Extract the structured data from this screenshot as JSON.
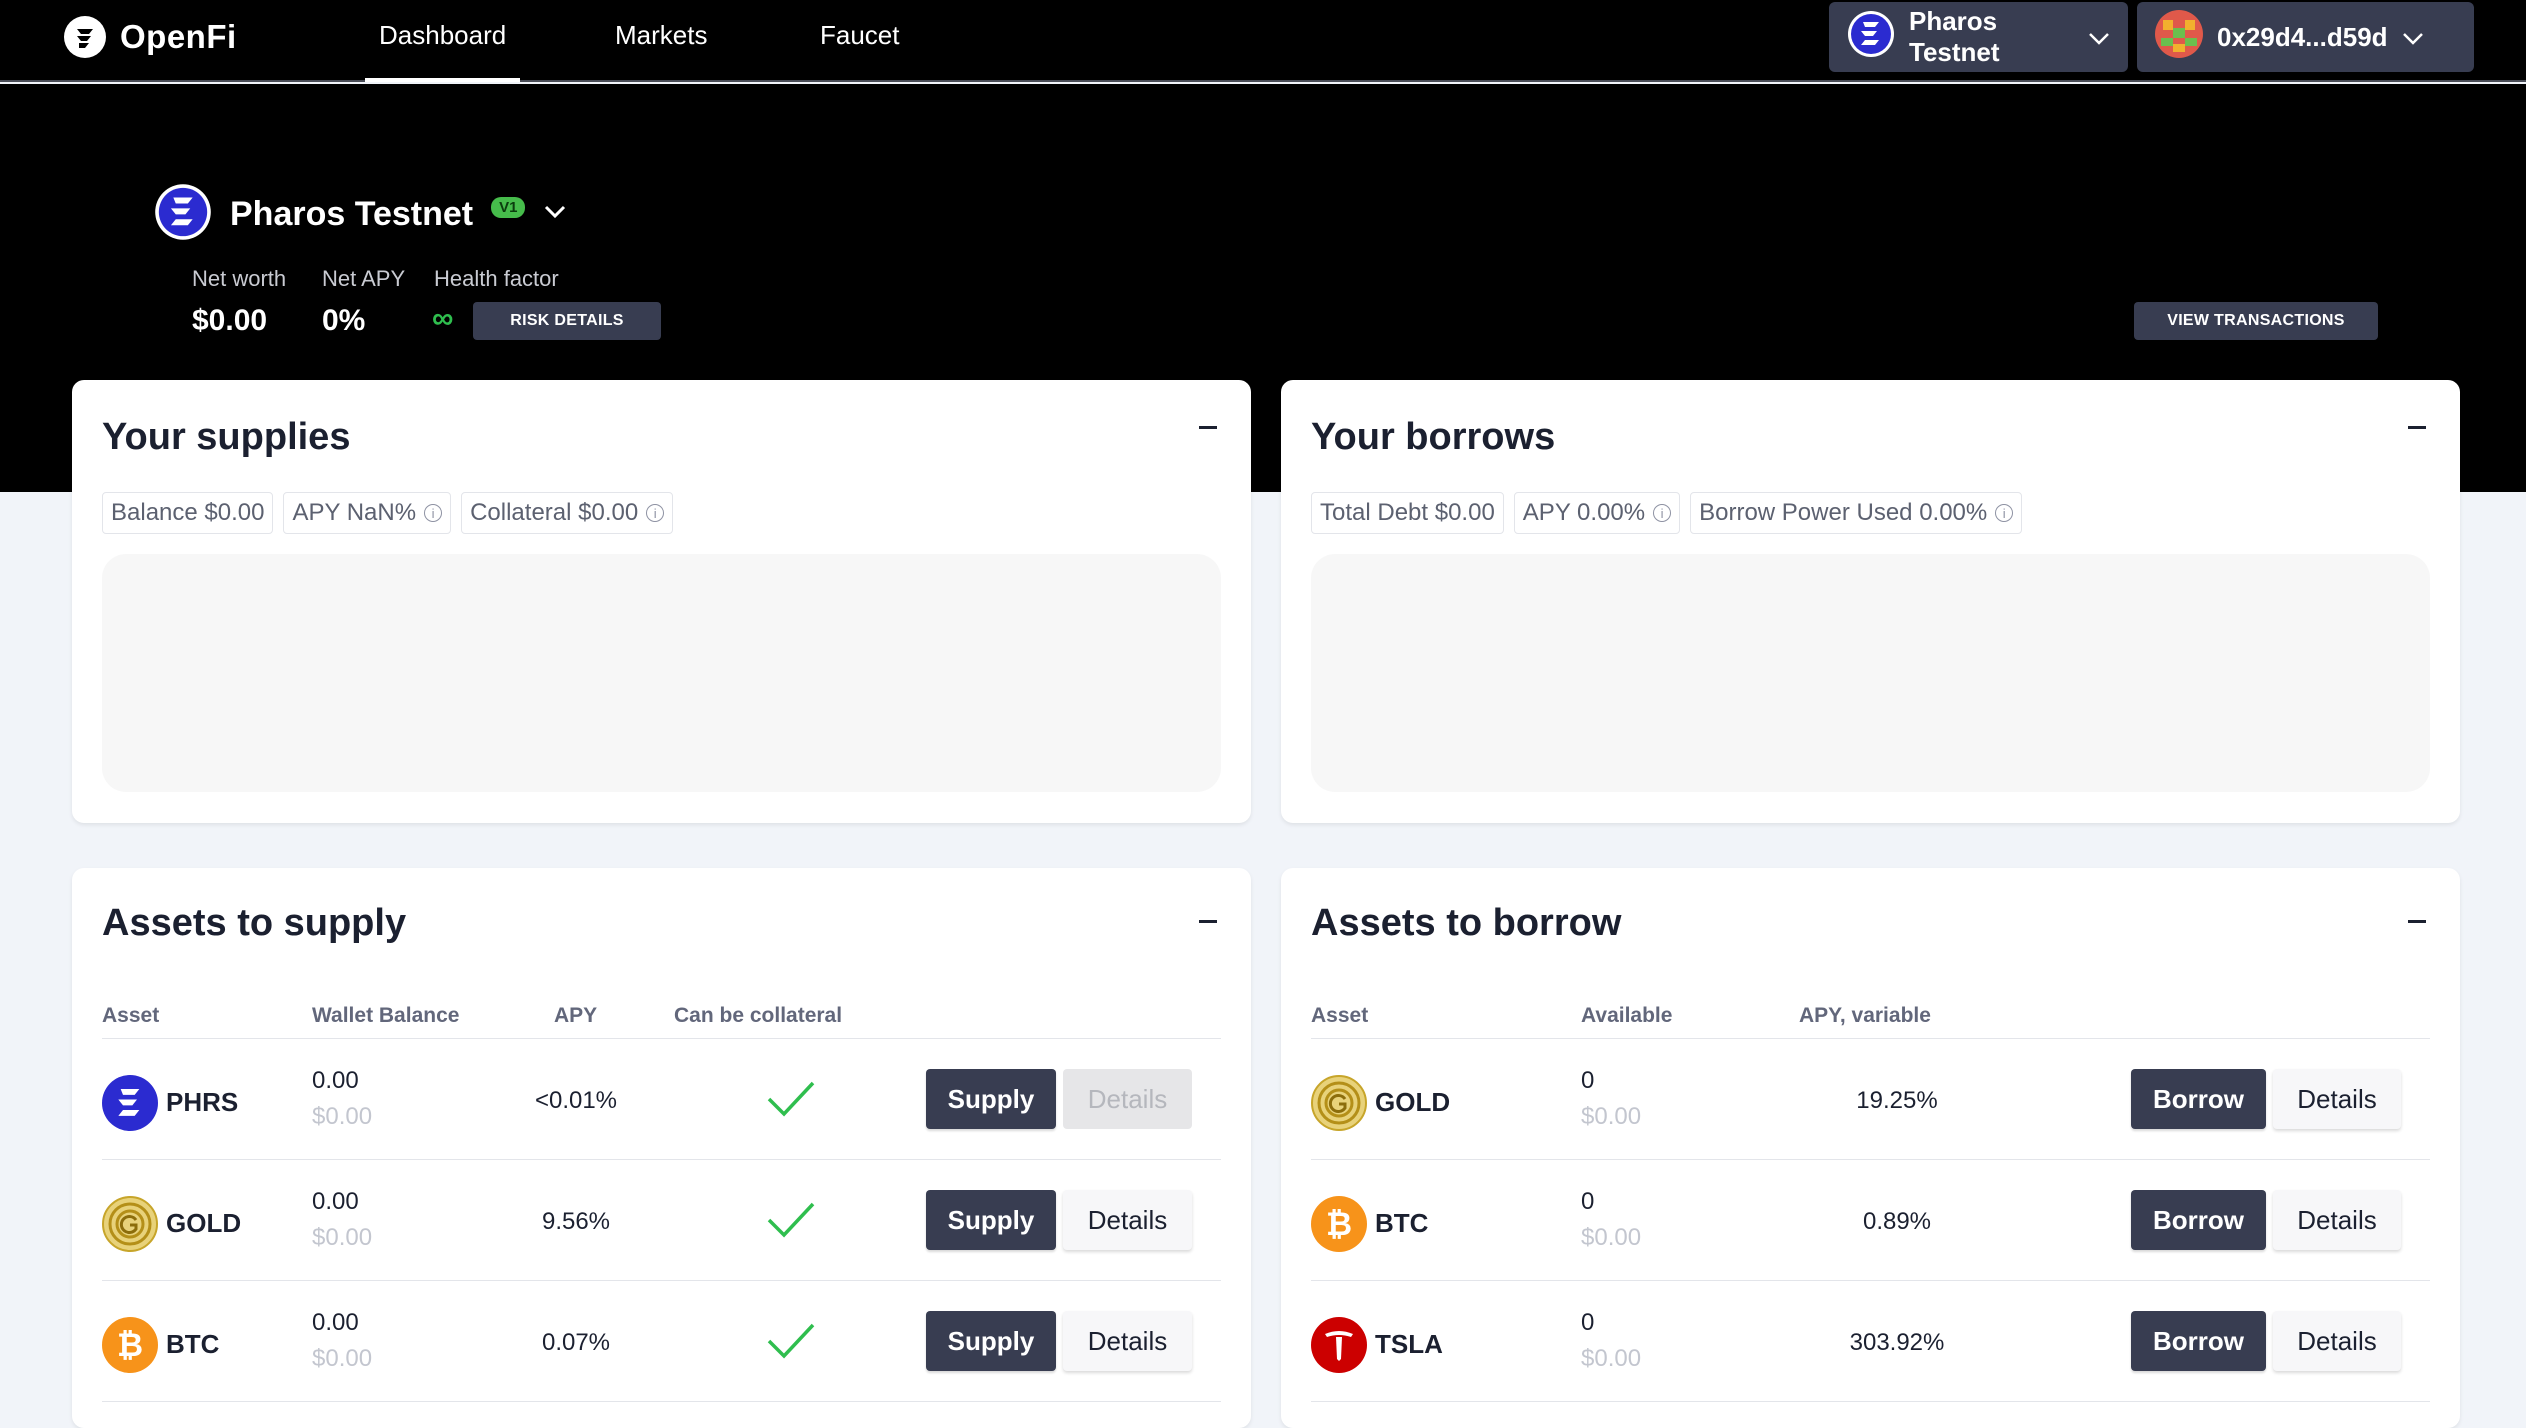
{
  "nav": {
    "brand": "OpenFi",
    "links": [
      "Dashboard",
      "Markets",
      "Faucet"
    ],
    "active": "Dashboard",
    "network_button": "Pharos Testnet",
    "wallet_button": "0x29d4...d59d"
  },
  "hero": {
    "network_name": "Pharos Testnet",
    "version_badge": "V1",
    "net_worth_label": "Net worth",
    "net_worth_value": "$0.00",
    "net_apy_label": "Net APY",
    "net_apy_value": "0%",
    "health_factor_label": "Health factor",
    "health_factor_value": "∞",
    "risk_details_button": "RISK DETAILS",
    "view_transactions_button": "VIEW TRANSACTIONS"
  },
  "supplies": {
    "title": "Your supplies",
    "chips": [
      "Balance $0.00",
      "APY NaN%",
      "Collateral $0.00"
    ]
  },
  "borrows": {
    "title": "Your borrows",
    "chips": [
      "Total Debt $0.00",
      "APY 0.00%",
      "Borrow Power Used 0.00%"
    ]
  },
  "assets_to_supply": {
    "title": "Assets to supply",
    "headers": [
      "Asset",
      "Wallet Balance",
      "APY",
      "Can be collateral"
    ],
    "rows": [
      {
        "symbol": "PHRS",
        "balance": "0.00",
        "usd": "$0.00",
        "apy": "<0.01%",
        "collateral": true,
        "action": "Supply",
        "details": "Details",
        "details_disabled": true
      },
      {
        "symbol": "GOLD",
        "balance": "0.00",
        "usd": "$0.00",
        "apy": "9.56%",
        "collateral": true,
        "action": "Supply",
        "details": "Details",
        "details_disabled": false
      },
      {
        "symbol": "BTC",
        "balance": "0.00",
        "usd": "$0.00",
        "apy": "0.07%",
        "collateral": true,
        "action": "Supply",
        "details": "Details",
        "details_disabled": false
      }
    ]
  },
  "assets_to_borrow": {
    "title": "Assets to borrow",
    "headers": [
      "Asset",
      "Available",
      "APY, variable"
    ],
    "rows": [
      {
        "symbol": "GOLD",
        "available": "0",
        "usd": "$0.00",
        "apy": "19.25%",
        "action": "Borrow",
        "details": "Details"
      },
      {
        "symbol": "BTC",
        "available": "0",
        "usd": "$0.00",
        "apy": "0.89%",
        "action": "Borrow",
        "details": "Details"
      },
      {
        "symbol": "TSLA",
        "available": "0",
        "usd": "$0.00",
        "apy": "303.92%",
        "action": "Borrow",
        "details": "Details"
      }
    ]
  },
  "colors": {
    "accent_dark": "#383d51",
    "health_green": "#2fbe4e",
    "check_green": "#2fbe4e",
    "pharos_blue": "#2b2bd0",
    "btc_orange": "#f7931a",
    "tsla_red": "#cc0000",
    "gold": "#d8b93a"
  },
  "icons": {
    "pharos": "pharos-logo-icon",
    "gold": "gold-coin-icon",
    "btc": "bitcoin-icon",
    "tsla": "tesla-icon",
    "check": "check-icon",
    "info": "info-icon",
    "chevron": "chevron-down-icon",
    "collapse": "minus-icon"
  }
}
